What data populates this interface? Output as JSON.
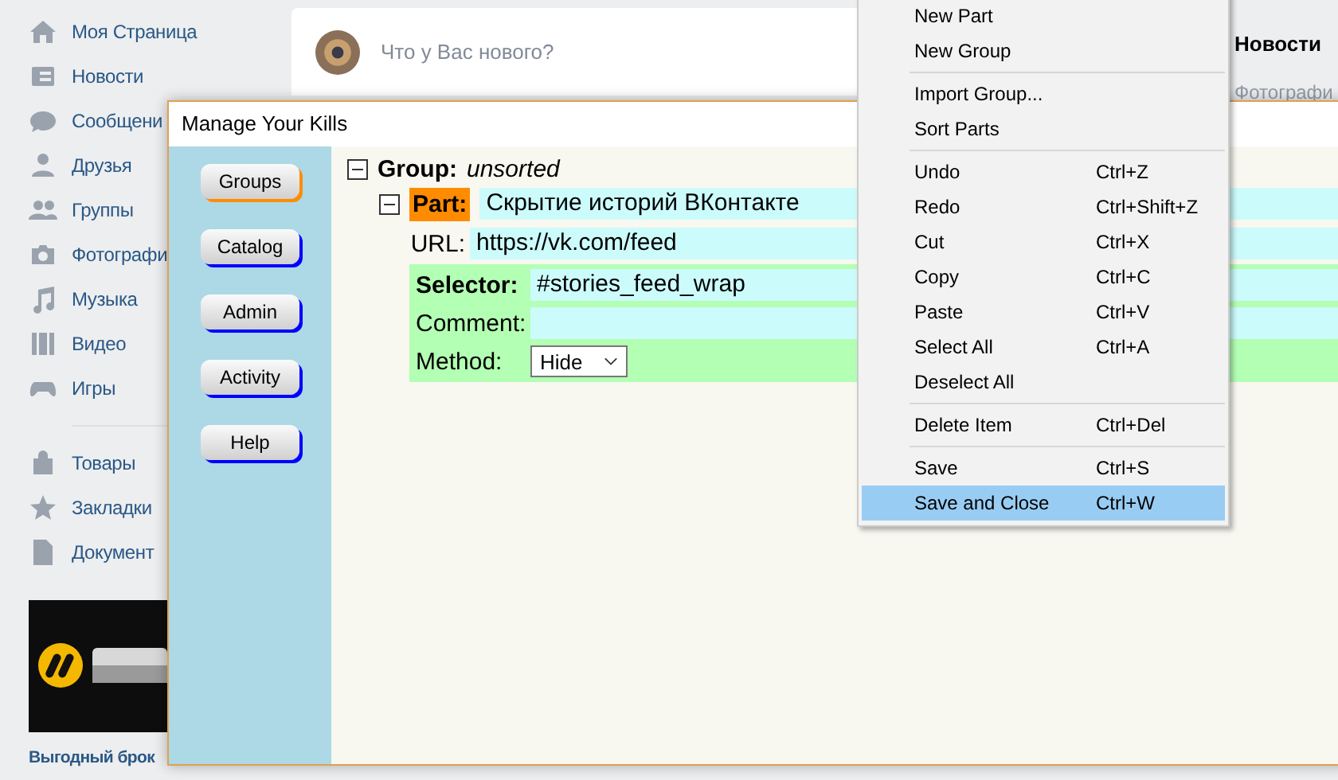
{
  "sidebar": {
    "sections": [
      [
        {
          "label": "Моя Страница"
        },
        {
          "label": "Новости"
        },
        {
          "label": "Сообщени"
        },
        {
          "label": "Друзья"
        },
        {
          "label": "Группы"
        },
        {
          "label": "Фотографи"
        },
        {
          "label": "Музыка"
        },
        {
          "label": "Видео"
        },
        {
          "label": "Игры"
        }
      ],
      [
        {
          "label": "Товары"
        },
        {
          "label": "Закладки"
        },
        {
          "label": "Документ"
        }
      ]
    ],
    "ad": {
      "kind": "picture",
      "caption": "Выгодный брок"
    }
  },
  "feed": {
    "post_box": {
      "placeholder": "Что у Вас нового?"
    }
  },
  "right_column": {
    "title": "Новости",
    "link": "Фотографи"
  },
  "dialog": {
    "title": "Manage Your Kills",
    "nav": [
      {
        "label": "Groups",
        "selected": true
      },
      {
        "label": "Catalog",
        "selected": false
      },
      {
        "label": "Admin",
        "selected": false
      },
      {
        "label": "Activity",
        "selected": false
      },
      {
        "label": "Help",
        "selected": false
      }
    ],
    "group": {
      "label": "Group:",
      "name": "unsorted",
      "expanded": true,
      "part": {
        "label": "Part:",
        "name": "Скрытие историй ВКонтакте",
        "expanded": true,
        "url_label": "URL:",
        "url": "https://vk.com/feed",
        "selector_label": "Selector:",
        "selector": "#stories_feed_wrap",
        "comment_label": "Comment:",
        "method_label": "Method:",
        "method": "Hide"
      }
    }
  },
  "context_menu": {
    "sections": [
      [
        {
          "label": "New Part",
          "selected": false
        },
        {
          "label": "New Group",
          "selected": false
        }
      ],
      [
        {
          "label": "Import Group...",
          "selected": false
        },
        {
          "label": "Sort Parts",
          "selected": false
        }
      ],
      [
        {
          "label": "Undo",
          "shortcut": "Ctrl+Z",
          "selected": false
        },
        {
          "label": "Redo",
          "shortcut": "Ctrl+Shift+Z",
          "selected": false
        },
        {
          "label": "Cut",
          "shortcut": "Ctrl+X",
          "selected": false
        },
        {
          "label": "Copy",
          "shortcut": "Ctrl+C",
          "selected": false
        },
        {
          "label": "Paste",
          "shortcut": "Ctrl+V",
          "selected": false
        },
        {
          "label": "Select All",
          "shortcut": "Ctrl+A",
          "selected": false
        },
        {
          "label": "Deselect All",
          "selected": false
        }
      ],
      [
        {
          "label": "Delete Item",
          "shortcut": "Ctrl+Del",
          "selected": false
        }
      ],
      [
        {
          "label": "Save",
          "shortcut": "Ctrl+S",
          "selected": false
        },
        {
          "label": "Save and Close",
          "shortcut": "Ctrl+W",
          "selected": true
        }
      ]
    ]
  }
}
